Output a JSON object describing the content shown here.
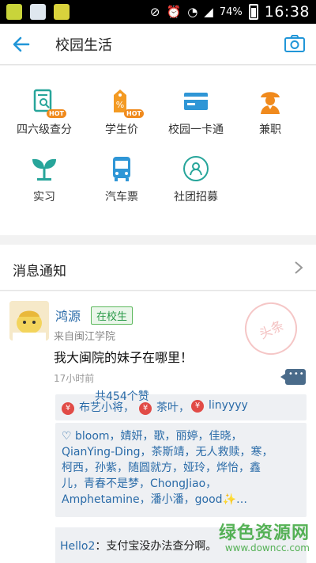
{
  "status_bar": {
    "battery": "74%",
    "time": "16:38"
  },
  "header": {
    "title": "校园生活"
  },
  "grid": {
    "items": [
      {
        "label": "四六级查分",
        "icon": "exam-search-icon",
        "hot": "HOT",
        "color": "#27a59a"
      },
      {
        "label": "学生价",
        "icon": "discount-tag-icon",
        "hot": "HOT",
        "color": "#f39a23"
      },
      {
        "label": "校园一卡通",
        "icon": "campus-card-icon",
        "hot": "",
        "color": "#2f96d6"
      },
      {
        "label": "兼职",
        "icon": "part-time-worker-icon",
        "hot": "",
        "color": "#f08a1d"
      },
      {
        "label": "实习",
        "icon": "sprout-icon",
        "hot": "",
        "color": "#27a59a"
      },
      {
        "label": "汽车票",
        "icon": "bus-icon",
        "hot": "",
        "color": "#2f96d6"
      },
      {
        "label": "社团招募",
        "icon": "club-recruit-icon",
        "hot": "",
        "color": "#27a59a"
      }
    ]
  },
  "notice": {
    "label": "消息通知"
  },
  "post": {
    "username": "鸿源",
    "badge": "在校生",
    "origin": "来自闽江学院",
    "stamp": "头条",
    "text": "我大闽院的妹子在哪里！",
    "time": "17小时前",
    "gifts": [
      "布艺小将，",
      "茶叶，",
      "linyyyy"
    ],
    "likes": "♡ bloom，婧妍，歌，丽婷，佳晓，QianYing-Ding，茶斯靖，无人救赎，寒，柯西，孙紫，随圆就方，娅玲，烨怡，鑫儿，青春不是梦，ChongJiao，Amphetamine，潘小潘，good✨…",
    "likes_count": "共454个赞",
    "reply_user": "Hello2",
    "reply_text": "：支付宝没办法查分啊。"
  },
  "watermark": {
    "main": "绿色资源网",
    "sub": "www.downcc.com"
  }
}
